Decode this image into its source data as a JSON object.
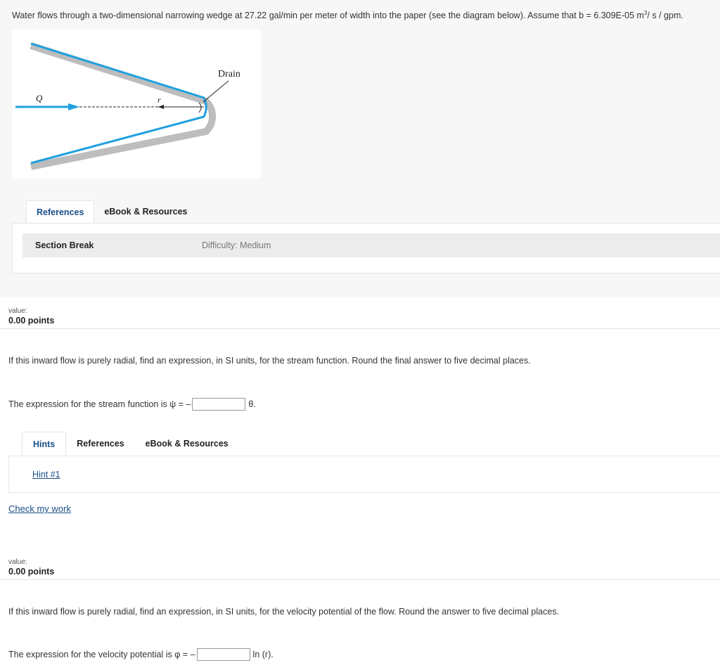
{
  "problem": {
    "intro_main": "Water flows through a two-dimensional narrowing wedge at 27.22 gal/min per meter of width into the paper (see the diagram below). Assume that b = 6.309E-05 m",
    "intro_sup": "3",
    "intro_end": "/ s / gpm."
  },
  "diagram": {
    "drain_label": "Drain",
    "q_label": "Q",
    "r_label": "r",
    "wall_color": "#1ea0e0",
    "shadow_color": "#bdbdbd"
  },
  "top_tabs": [
    {
      "label": "References"
    },
    {
      "label": "eBook & Resources"
    }
  ],
  "section": {
    "label": "Section Break",
    "difficulty": "Difficulty: Medium"
  },
  "q1": {
    "value_label": "value:",
    "points": "0.00 points",
    "question": "If this inward flow is purely radial, find an expression, in SI units, for the stream function. Round the final answer to five decimal places.",
    "prefix": "The expression for the stream function is ψ = –",
    "input_value": "",
    "suffix": "θ."
  },
  "hint_tabs": [
    {
      "label": "Hints"
    },
    {
      "label": "References"
    },
    {
      "label": "eBook & Resources"
    }
  ],
  "hint_link": "Hint #1",
  "check_link": "Check my work",
  "q2": {
    "value_label": "value:",
    "points": "0.00 points",
    "question": "If this inward flow is purely radial, find an expression, in SI units, for the velocity potential of the flow. Round the answer to five decimal places.",
    "prefix": "The expression for the velocity potential is φ = –",
    "input_value": "",
    "suffix": "ln (r)."
  }
}
